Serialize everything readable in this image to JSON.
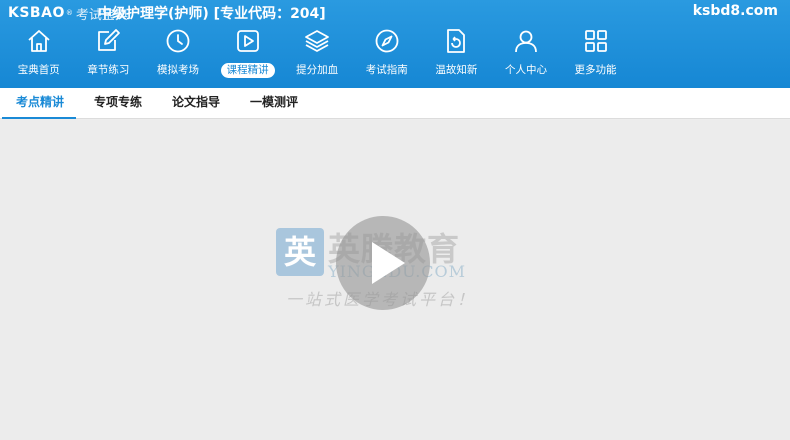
{
  "header": {
    "logo_text": "KSBAO",
    "logo_reg": "®",
    "logo_cn": "考试宝典",
    "title": "中级护理学(护师) [专业代码：204]",
    "site": "ksbd8.com",
    "bg_color": "#1a8ad6"
  },
  "nav": {
    "items": [
      {
        "label": "宝典首页",
        "icon": "home-icon"
      },
      {
        "label": "章节练习",
        "icon": "edit-icon"
      },
      {
        "label": "模拟考场",
        "icon": "clock-icon"
      },
      {
        "label": "课程精讲",
        "icon": "play-icon",
        "active": true
      },
      {
        "label": "提分加血",
        "icon": "layers-icon"
      },
      {
        "label": "考试指南",
        "icon": "compass-icon"
      },
      {
        "label": "温故知新",
        "icon": "refresh-doc-icon"
      },
      {
        "label": "个人中心",
        "icon": "user-icon"
      },
      {
        "label": "更多功能",
        "icon": "grid-icon"
      }
    ]
  },
  "tabs": [
    {
      "label": "考点精讲",
      "active": true
    },
    {
      "label": "专项专练"
    },
    {
      "label": "论文指导"
    },
    {
      "label": "一模测评"
    }
  ],
  "player": {
    "watermark_box": "英",
    "watermark_cn": "英腾教育",
    "watermark_en": "YINGEDU.COM",
    "watermark_slogan": "一站式医学考试平台！",
    "play_icon": "play-icon"
  }
}
